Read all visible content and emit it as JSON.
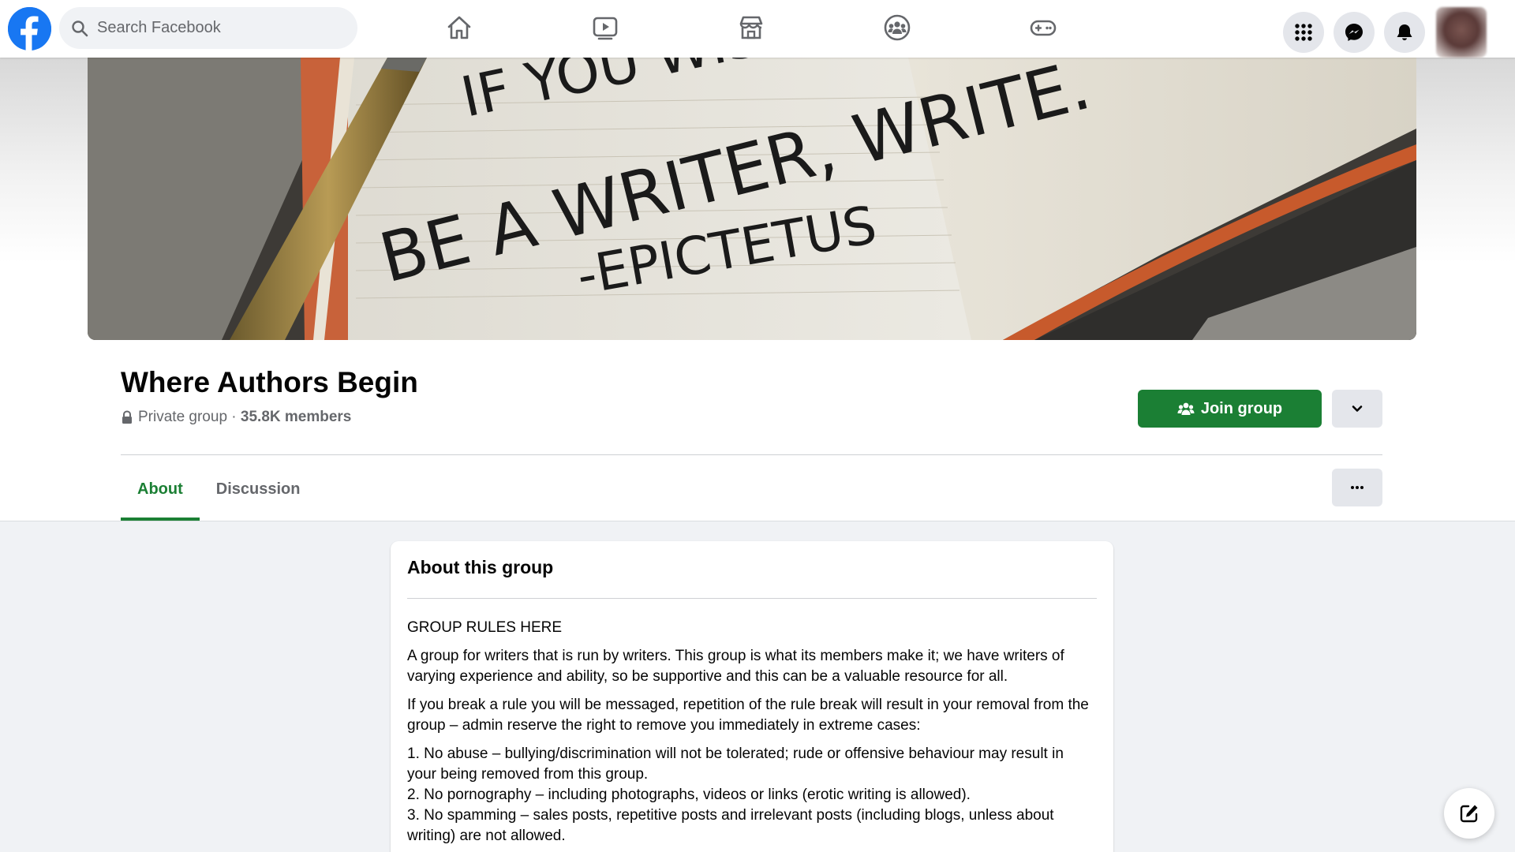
{
  "topbar": {
    "search_placeholder": "Search Facebook",
    "nav_icons": [
      "home-icon",
      "watch-icon",
      "marketplace-icon",
      "groups-icon",
      "gaming-icon"
    ],
    "right_icons": [
      "menu-grid-icon",
      "messenger-icon",
      "notifications-bell-icon"
    ]
  },
  "group": {
    "name": "Where Authors Begin",
    "privacy": "Private group",
    "separator": " · ",
    "members": "35.8K members",
    "cover_quote": [
      "IF YOU WISH TO",
      "BE A WRITER, WRITE.",
      "-EPICTETUS"
    ]
  },
  "actions": {
    "join_label": "Join group"
  },
  "tabs": [
    {
      "label": "About",
      "active": true
    },
    {
      "label": "Discussion",
      "active": false
    }
  ],
  "about": {
    "title": "About this group",
    "paragraphs": [
      "GROUP RULES HERE",
      "A group for writers that is run by writers. This group is what its members make it; we have writers of varying experience and ability, so be supportive and this can be a valuable resource for all.",
      "If you break a rule you will be messaged, repetition of the rule break will result in your removal from the group – admin reserve the right to remove you immediately in extreme cases:"
    ],
    "rules": [
      "1. No abuse – bullying/discrimination will not be tolerated; rude or offensive behaviour may result in your being removed from this group.",
      "2. No pornography – including photographs, videos or links (erotic writing is allowed).",
      "3. No spamming – sales posts, repetitive posts and irrelevant posts (including blogs, unless about writing) are not allowed."
    ]
  },
  "colors": {
    "facebook_blue": "#1877f2",
    "group_green": "#1b7f34",
    "page_bg": "#f0f2f5",
    "secondary_text": "#65676b"
  }
}
